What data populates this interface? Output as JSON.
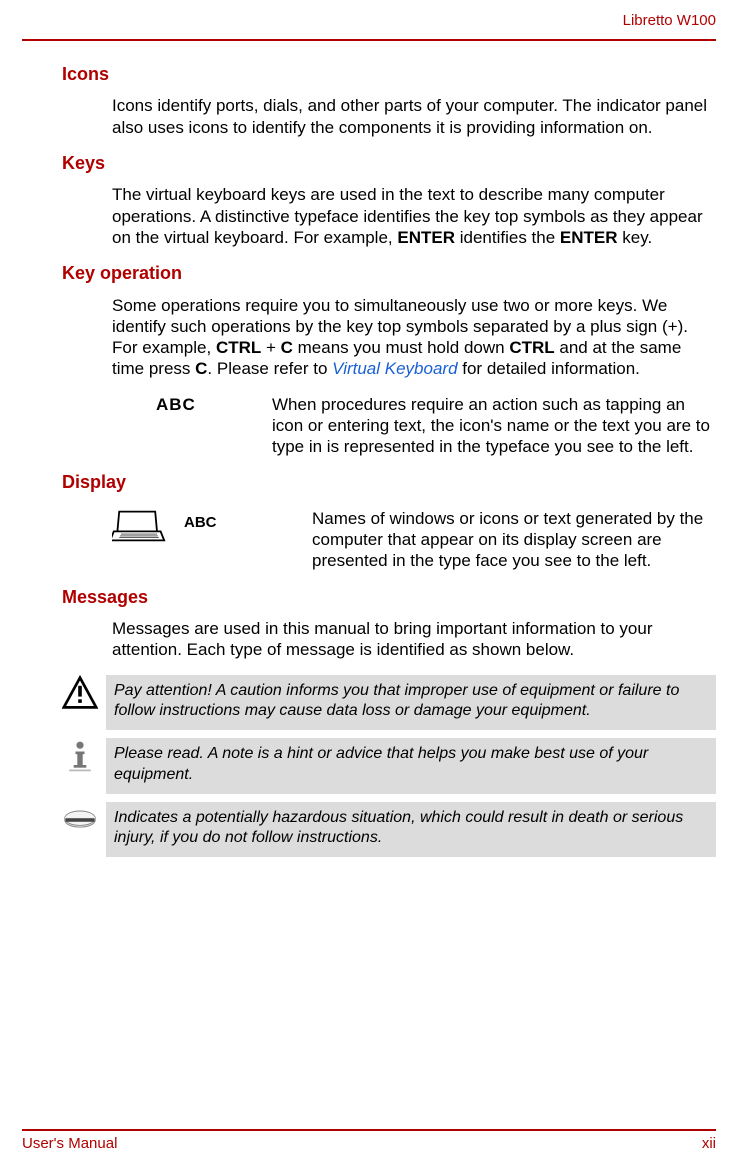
{
  "header": {
    "product": "Libretto W100"
  },
  "sections": {
    "icons": {
      "heading": "Icons",
      "text": "Icons identify ports, dials, and other parts of your computer. The indicator panel also uses icons to identify the components it is providing information on."
    },
    "keys": {
      "heading": "Keys",
      "text_pre": "The virtual keyboard keys are used in the text to describe many computer operations. A distinctive typeface identifies the key top symbols as they appear on the virtual keyboard. For example, ",
      "key1": "ENTER",
      "text_mid": " identifies the ",
      "key2": "ENTER",
      "text_post": " key."
    },
    "keyop": {
      "heading": "Key operation",
      "text_pre": "Some operations require you to simultaneously use two or more keys. We identify such operations by the key top symbols separated by a plus sign (+). For example, ",
      "k1": "CTRL",
      "plus": " + ",
      "k2": "C",
      "text_mid": " means you must hold down ",
      "k3": "CTRL",
      "text_mid2": " and at the same time press ",
      "k4": "C",
      "text_post": ". Please refer to ",
      "link": "Virtual Keyboard",
      "text_end": " for detailed information.",
      "sample_label": "ABC",
      "sample_desc": "When procedures require an action such as tapping an icon or entering text, the icon's name or the text you are to type in is represented in the typeface you see to the left."
    },
    "display": {
      "heading": "Display",
      "sample_label": "ABC",
      "sample_desc": "Names of windows or icons or text generated by the computer that appear on its display screen are presented in the type face you see to the left."
    },
    "messages": {
      "heading": "Messages",
      "intro": "Messages are used in this manual to bring important information to your attention. Each type of message is identified as shown below.",
      "caution": "Pay attention! A caution informs you that improper use of equipment or failure to follow instructions may cause data loss or damage your equipment.",
      "note": "Please read. A note is a hint or advice that helps you make best use of your equipment.",
      "hazard": "Indicates a potentially hazardous situation, which could result in death or serious injury, if you do not follow instructions."
    }
  },
  "footer": {
    "left": "User's Manual",
    "right": "xii"
  }
}
